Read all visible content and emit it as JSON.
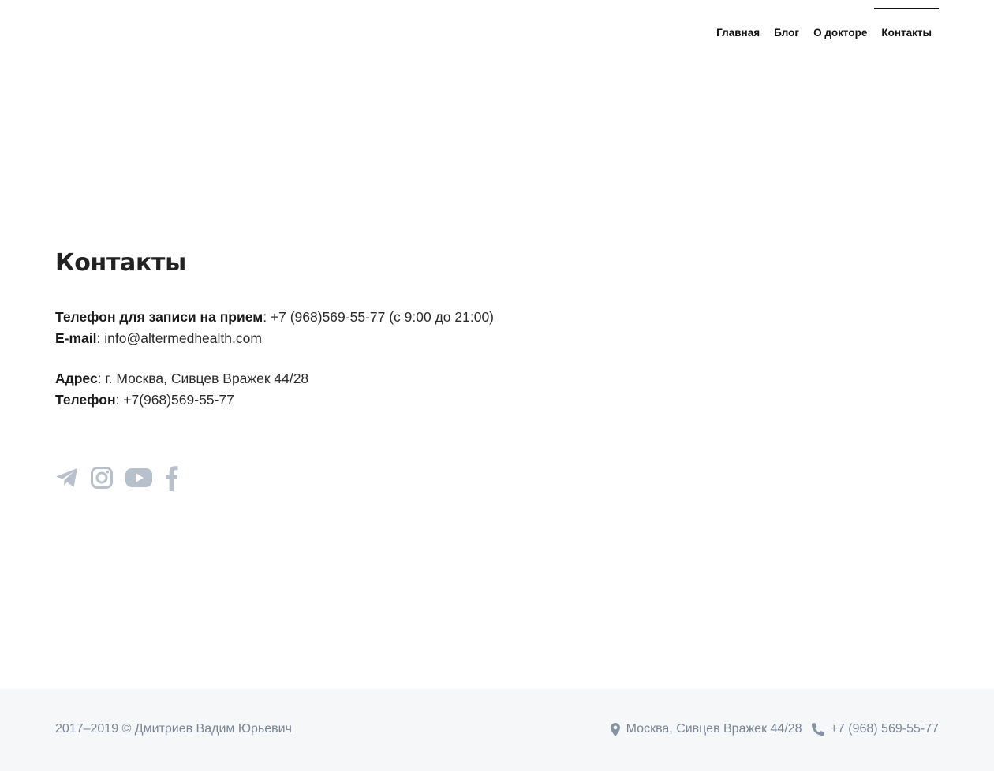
{
  "nav": {
    "items": [
      {
        "label": "Главная",
        "active": false
      },
      {
        "label": "Блог",
        "active": false
      },
      {
        "label": "О докторе",
        "active": false
      },
      {
        "label": "Контакты",
        "active": true
      }
    ]
  },
  "page": {
    "title": "Контакты"
  },
  "contacts": {
    "appointment_label": "Телефон для записи на прием",
    "appointment_value": ": +7 (968)569-55-77 (с 9:00 до 21:00)",
    "email_label": "E-mail",
    "email_value": ": info@altermedhealth.com",
    "address_label": "Адрес",
    "address_value": ": г. Москва, Сивцев Вражек 44/28",
    "phone_label": "Телефон",
    "phone_value": ": +7(968)569-55-77"
  },
  "social": {
    "icons": [
      "telegram-icon",
      "instagram-icon",
      "youtube-icon",
      "facebook-icon"
    ],
    "color": "#b7c0cb"
  },
  "footer": {
    "copyright": "2017–2019 © Дмитриев Вадим Юрьевич",
    "address": "Москва, Сивцев Вражек 44/28",
    "phone": "+7 (968) 569-55-77",
    "icon_color": "#8592a3",
    "background": "#f6f7f9"
  }
}
